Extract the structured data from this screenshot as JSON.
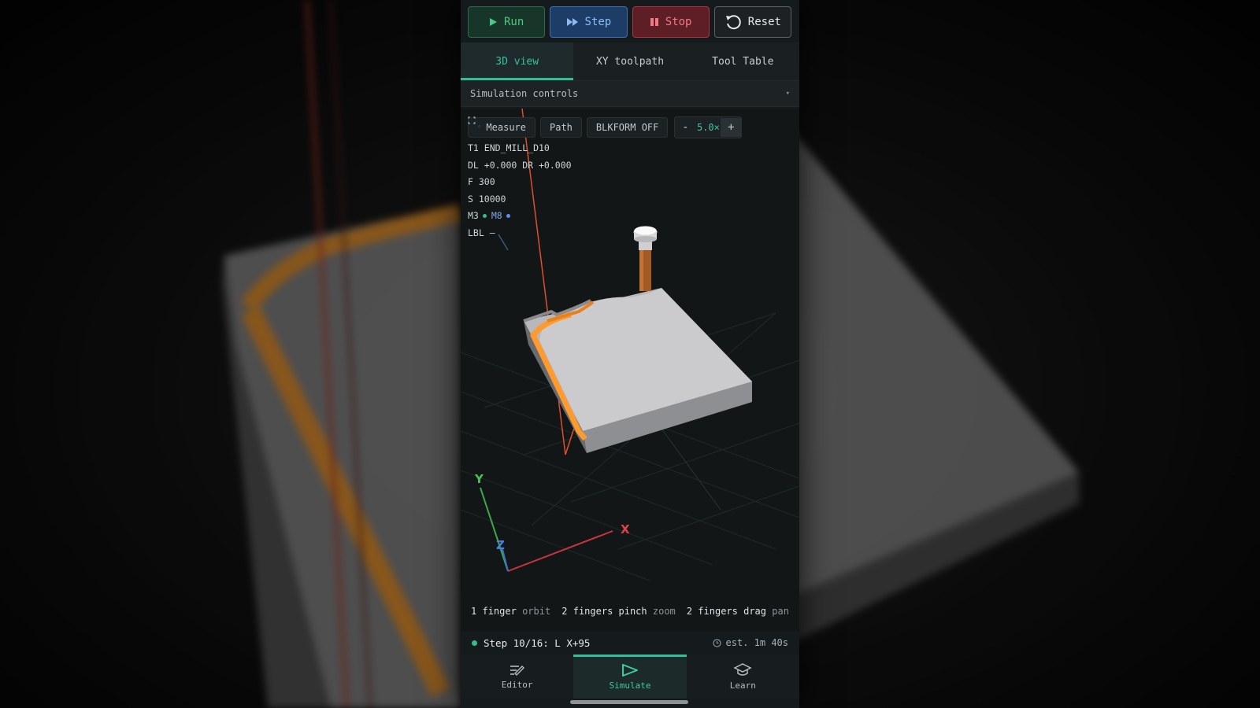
{
  "toolbar": {
    "run_label": "Run",
    "step_label": "Step",
    "stop_label": "Stop",
    "reset_label": "Reset"
  },
  "tabs": [
    {
      "label": "3D view",
      "active": true
    },
    {
      "label": "XY toolpath",
      "active": false
    },
    {
      "label": "Tool Table",
      "active": false
    }
  ],
  "sim_controls": {
    "label": "Simulation controls",
    "caret": "▾"
  },
  "chips": {
    "measure_label": "Measure",
    "path_label": "Path",
    "blkform_label": "BLKFORM OFF",
    "zoom_minus": "-",
    "zoom_value": "5.0×",
    "zoom_plus": "+"
  },
  "readout": {
    "tool": "T1 END_MILL_D10",
    "offsets": "DL +0.000 DR +0.000",
    "feed": "F 300",
    "spindle": "S 10000",
    "m3": "M3",
    "m8": "M8",
    "label": "LBL —"
  },
  "axes": {
    "x": "X",
    "y": "Y",
    "z": "Z"
  },
  "hints": {
    "orbit_bold": "1 finger",
    "orbit_muted": "orbit",
    "zoom_bold": "2 fingers pinch",
    "zoom_muted": "zoom",
    "pan_bold": "2 fingers drag",
    "pan_muted": "pan"
  },
  "status": {
    "step": "Step 10/16: L X+95",
    "estimate": "est. 1m 40s"
  },
  "nav": [
    {
      "label": "Editor",
      "icon": "pencil-list-icon",
      "active": false
    },
    {
      "label": "Simulate",
      "icon": "play-outline-icon",
      "active": true
    },
    {
      "label": "Learn",
      "icon": "graduation-cap-icon",
      "active": false
    }
  ],
  "colors": {
    "accent": "#2fbf9a",
    "run": "#4cc884",
    "step": "#8dbcf5",
    "stop": "#f07a84",
    "toolpath": "#ff9a2e",
    "axis_x": "#e0404a",
    "axis_y": "#4cc05a",
    "axis_z": "#4a7ee0"
  }
}
